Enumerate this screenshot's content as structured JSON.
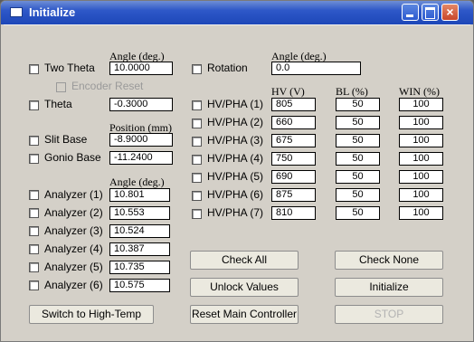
{
  "window": {
    "title": "Initialize",
    "close_glyph": "×"
  },
  "left": {
    "angle_header_1": "Angle (deg.)",
    "two_theta": {
      "label": "Two Theta",
      "value": "10.0000"
    },
    "encoder_reset": "Encoder Reset",
    "theta": {
      "label": "Theta",
      "value": "-0.3000"
    },
    "position_header": "Position (mm)",
    "slit_base": {
      "label": "Slit Base",
      "value": "-8.9000"
    },
    "gonio_base": {
      "label": "Gonio Base",
      "value": "-11.2400"
    },
    "angle_header_2": "Angle (deg.)",
    "analyzers": [
      {
        "label": "Analyzer (1)",
        "value": "10.801"
      },
      {
        "label": "Analyzer (2)",
        "value": "10.553"
      },
      {
        "label": "Analyzer (3)",
        "value": "10.524"
      },
      {
        "label": "Analyzer (4)",
        "value": "10.387"
      },
      {
        "label": "Analyzer (5)",
        "value": "10.735"
      },
      {
        "label": "Analyzer (6)",
        "value": "10.575"
      }
    ]
  },
  "right": {
    "angle_header": "Angle (deg.)",
    "rotation": {
      "label": "Rotation",
      "value": "0.0"
    },
    "col_hv": "HV (V)",
    "col_bl": "BL (%)",
    "col_win": "WIN (%)",
    "hvpha": [
      {
        "label": "HV/PHA (1)",
        "hv": "805",
        "bl": "50",
        "win": "100"
      },
      {
        "label": "HV/PHA (2)",
        "hv": "660",
        "bl": "50",
        "win": "100"
      },
      {
        "label": "HV/PHA (3)",
        "hv": "675",
        "bl": "50",
        "win": "100"
      },
      {
        "label": "HV/PHA (4)",
        "hv": "750",
        "bl": "50",
        "win": "100"
      },
      {
        "label": "HV/PHA (5)",
        "hv": "690",
        "bl": "50",
        "win": "100"
      },
      {
        "label": "HV/PHA (6)",
        "hv": "875",
        "bl": "50",
        "win": "100"
      },
      {
        "label": "HV/PHA (7)",
        "hv": "810",
        "bl": "50",
        "win": "100"
      }
    ]
  },
  "buttons": {
    "check_all": "Check All",
    "check_none": "Check None",
    "unlock_values": "Unlock Values",
    "initialize": "Initialize",
    "switch_high_temp": "Switch to High-Temp",
    "reset_main": "Reset Main Controller",
    "stop": "STOP"
  }
}
